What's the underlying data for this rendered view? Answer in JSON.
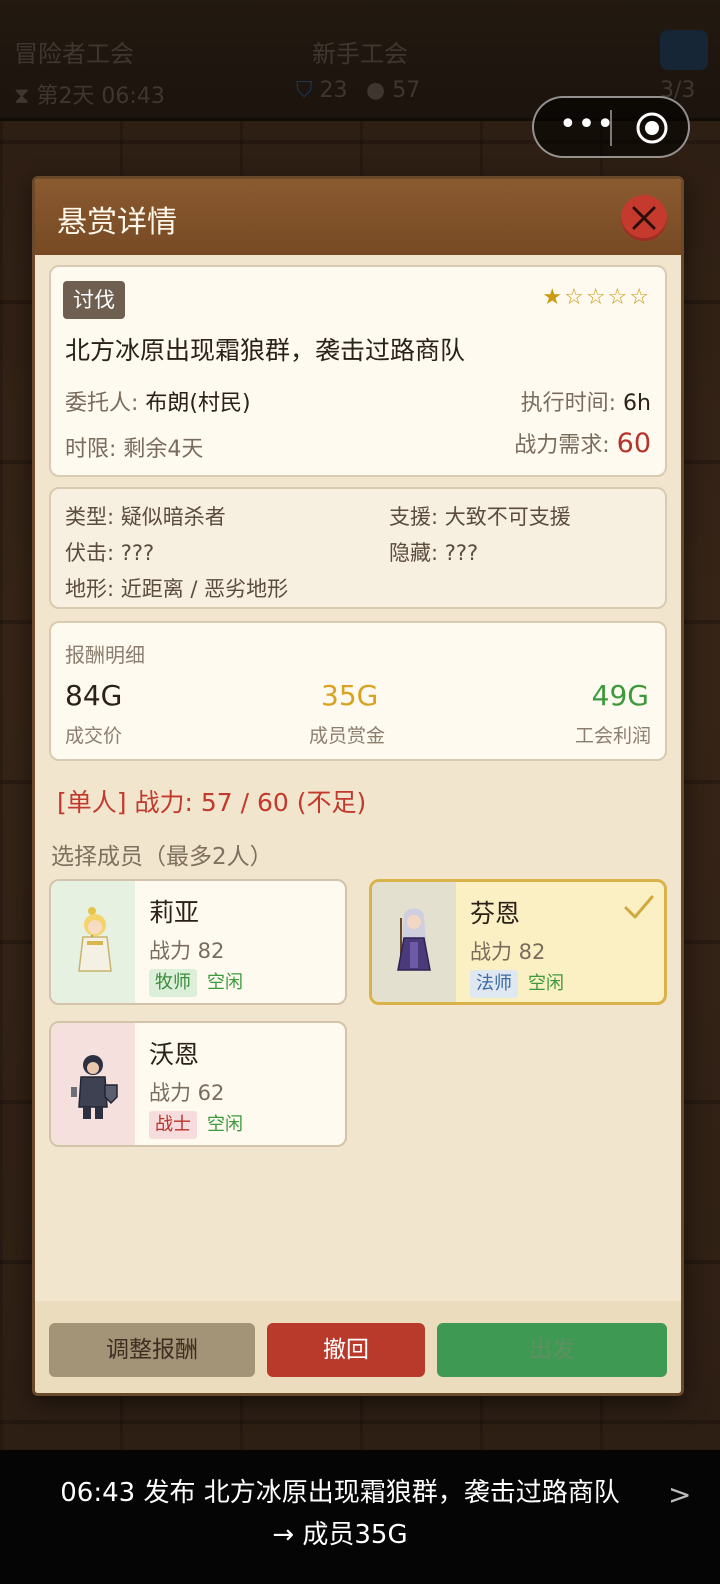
{
  "background": {
    "guild_title": "冒险者工会",
    "guild_rank": "新手工会",
    "day_time": "第2天 06:43",
    "shield_count": "23",
    "gold_count": "57",
    "member_count": "3/3"
  },
  "dialog": {
    "title": "悬赏详情",
    "close_icon": "close-icon"
  },
  "quest": {
    "tag": "讨伐",
    "stars_filled": 1,
    "stars_total": 5,
    "title": "北方冰原出现霜狼群，袭击过路商队",
    "client_label": "委托人: ",
    "client_value": "布朗(村民)",
    "duration_label": "执行时间: ",
    "duration_value": "6h",
    "deadline_label": "时限: ",
    "deadline_value": "剩余4天",
    "power_label": "战力需求: ",
    "power_value": "60"
  },
  "info": {
    "type": "类型: 疑似暗杀者",
    "support": "支援: 大致不可支援",
    "ambush": "伏击: ???",
    "stealth": "隐藏: ???",
    "terrain": "地形: 近距离 / 恶劣地形"
  },
  "reward": {
    "heading": "报酬明细",
    "deal_value": "84G",
    "deal_label": "成交价",
    "member_value": "35G",
    "member_label": "成员赏金",
    "guild_value": "49G",
    "guild_label": "工会利润"
  },
  "team_status": "[单人] 战力: 57 / 60 (不足)",
  "select_hint": "选择成员（最多2人）",
  "members": [
    {
      "name": "莉亚",
      "power": "战力 82",
      "class": "牧师",
      "status": "空闲",
      "selected": false
    },
    {
      "name": "芬恩",
      "power": "战力 82",
      "class": "法师",
      "status": "空闲",
      "selected": true
    },
    {
      "name": "沃恩",
      "power": "战力 62",
      "class": "战士",
      "status": "空闲",
      "selected": false
    }
  ],
  "buttons": {
    "adjust": "调整报酬",
    "withdraw": "撤回",
    "depart": "出发"
  },
  "log": {
    "line1": "06:43 发布 北方冰原出现霜狼群，袭击过路商队",
    "line2": "→ 成员35G",
    "chevron": ">"
  },
  "colors": {
    "accent_brown": "#8a5a30",
    "danger": "#b9392b",
    "success": "#3e9a52",
    "gold": "#d8a322"
  }
}
